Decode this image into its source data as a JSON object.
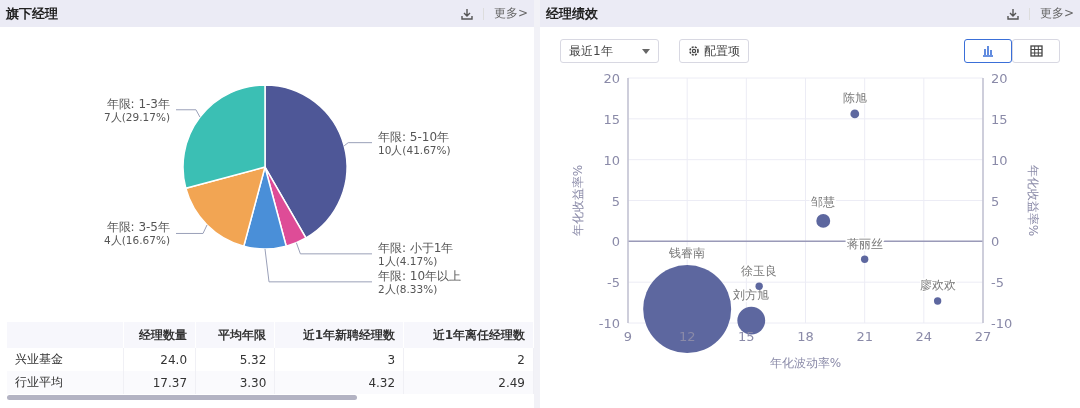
{
  "left_panel": {
    "title": "旗下经理",
    "more": "更多>",
    "chart_data": {
      "type": "pie",
      "categories": [
        "年限: 5-10年",
        "年限: 小于1年",
        "年限: 10年以上",
        "年限: 3-5年",
        "年限: 1-3年"
      ],
      "series": [
        {
          "values": [
            10,
            1,
            2,
            4,
            7
          ]
        }
      ],
      "colors": [
        "#4e5797",
        "#de4c97",
        "#4a8fd8",
        "#f2a553",
        "#3bbfb4"
      ],
      "value_labels": [
        "10人(41.67%)",
        "1人(4.17%)",
        "2人(8.33%)",
        "4人(16.67%)",
        "7人(29.17%)"
      ]
    },
    "table": {
      "columns": [
        "",
        "经理数量",
        "平均年限",
        "近1年新聘经理数",
        "近1年离任经理数"
      ],
      "rows": [
        [
          "兴业基金",
          "24.0",
          "5.32",
          "3",
          "2"
        ],
        [
          "行业平均",
          "17.37",
          "3.30",
          "4.32",
          "2.49"
        ]
      ]
    }
  },
  "right_panel": {
    "title": "经理绩效",
    "more": "更多>",
    "period_select": {
      "value": "最近1年"
    },
    "config_button": "配置项",
    "view_toggle": [
      {
        "kind": "chart",
        "selected": true
      },
      {
        "kind": "table",
        "selected": false
      }
    ],
    "right_axis": {
      "title": "年化收益率%",
      "ticks": [
        "20",
        "15",
        "10",
        "5",
        "0",
        "-5",
        "-10"
      ]
    },
    "chart_data": {
      "type": "scatter",
      "xlabel": "年化波动率%",
      "ylabel": "年化收益率%",
      "grid": true,
      "xlim": [
        9,
        27
      ],
      "ylim": [
        -10,
        20
      ],
      "xticks": [
        9,
        12,
        15,
        18,
        21,
        24,
        27
      ],
      "yticks": [
        -10,
        -5,
        0,
        5,
        10,
        15,
        20
      ],
      "series": [
        {
          "color": "#5d679f",
          "x": [
            12,
            15.25,
            15.65,
            18.9,
            20.5,
            21,
            24.7
          ],
          "values": [
            -8.3,
            -9.7,
            -5.5,
            2.5,
            15.6,
            -2.2,
            -7.3
          ],
          "sizes": [
            1,
            0.1,
            0.007,
            0.025,
            0.01,
            0.007,
            0.007
          ],
          "value_labels": [
            "钱睿南",
            "刘方旭",
            "徐玉良",
            "邹慧",
            "陈旭",
            "蒋丽丝",
            "廖欢欢"
          ]
        }
      ]
    }
  }
}
